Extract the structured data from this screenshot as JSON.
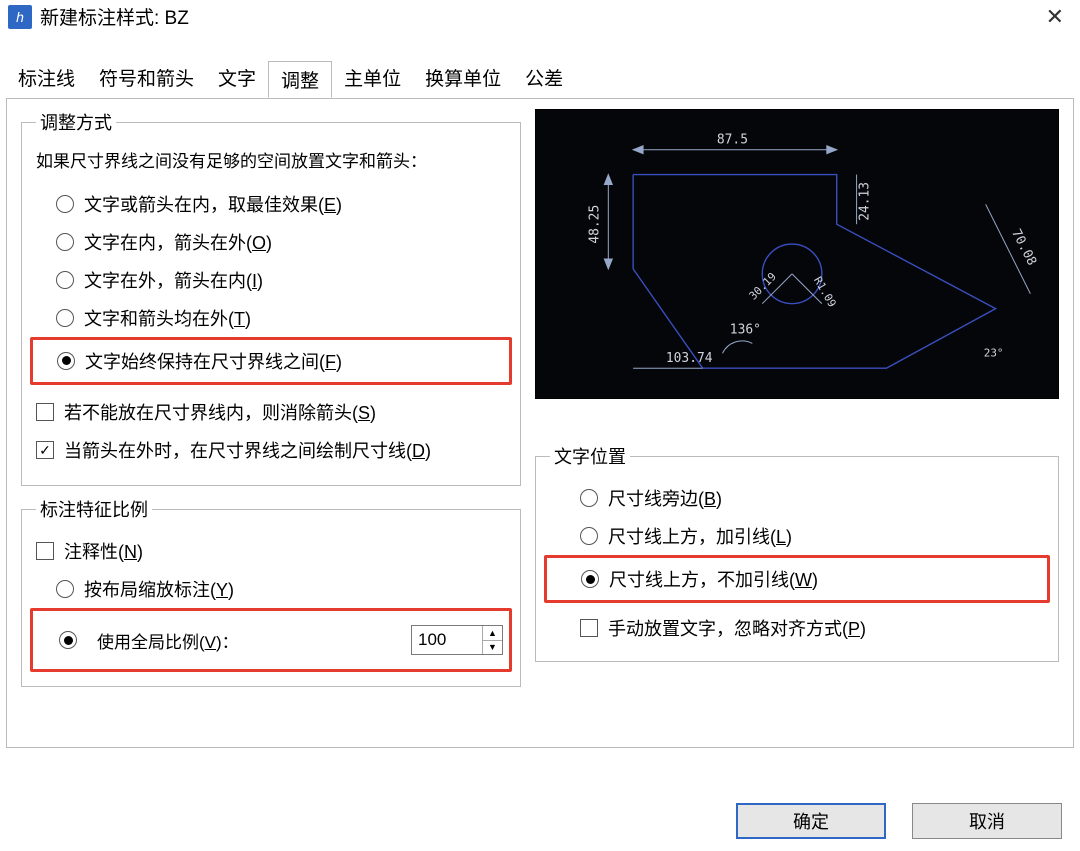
{
  "window": {
    "title": "新建标注样式: BZ",
    "close": "✕"
  },
  "tabs": [
    "标注线",
    "符号和箭头",
    "文字",
    "调整",
    "主单位",
    "换算单位",
    "公差"
  ],
  "active_tab_index": 3,
  "fit_method": {
    "legend": "调整方式",
    "intro": "如果尺寸界线之间没有足够的空间放置文字和箭头：",
    "options": {
      "best": "文字或箭头在内，取最佳效果(",
      "best_k": "E",
      "text_in": "文字在内，箭头在外(",
      "text_in_k": "O",
      "text_out": "文字在外，箭头在内(",
      "text_out_k": "I",
      "both_out": "文字和箭头均在外(",
      "both_out_k": "T",
      "always": "文字始终保持在尺寸界线之间(",
      "always_k": "F"
    },
    "suppress_arrow": "若不能放在尺寸界线内，则消除箭头(",
    "suppress_arrow_k": "S",
    "draw_dimline": "当箭头在外时，在尺寸界线之间绘制尺寸线(",
    "draw_dimline_k": "D",
    "close_paren": ")"
  },
  "scale": {
    "legend": "标注特征比例",
    "annotative": "注释性(",
    "annotative_k": "N",
    "layout": "按布局缩放标注(",
    "layout_k": "Y",
    "global": "使用全局比例(",
    "global_k": "V",
    "global_suffix": ")：",
    "value": "100"
  },
  "text_pos": {
    "legend": "文字位置",
    "beside": "尺寸线旁边(",
    "beside_k": "B",
    "above_leader": "尺寸线上方，加引线(",
    "above_leader_k": "L",
    "above_noleader": "尺寸线上方，不加引线(",
    "above_noleader_k": "W",
    "manual": "手动放置文字，忽略对齐方式(",
    "manual_k": "P"
  },
  "preview_dims": {
    "top": "87.5",
    "left": "48.25",
    "right_small": "24.13",
    "diag": "70.08",
    "bottom": "103.74",
    "angle": "136°",
    "radius1": "30.19",
    "radius2": "R1.09",
    "corner_angle": "23°"
  },
  "buttons": {
    "ok": "确定",
    "cancel": "取消"
  },
  "icons": {
    "up": "▲",
    "down": "▼"
  }
}
